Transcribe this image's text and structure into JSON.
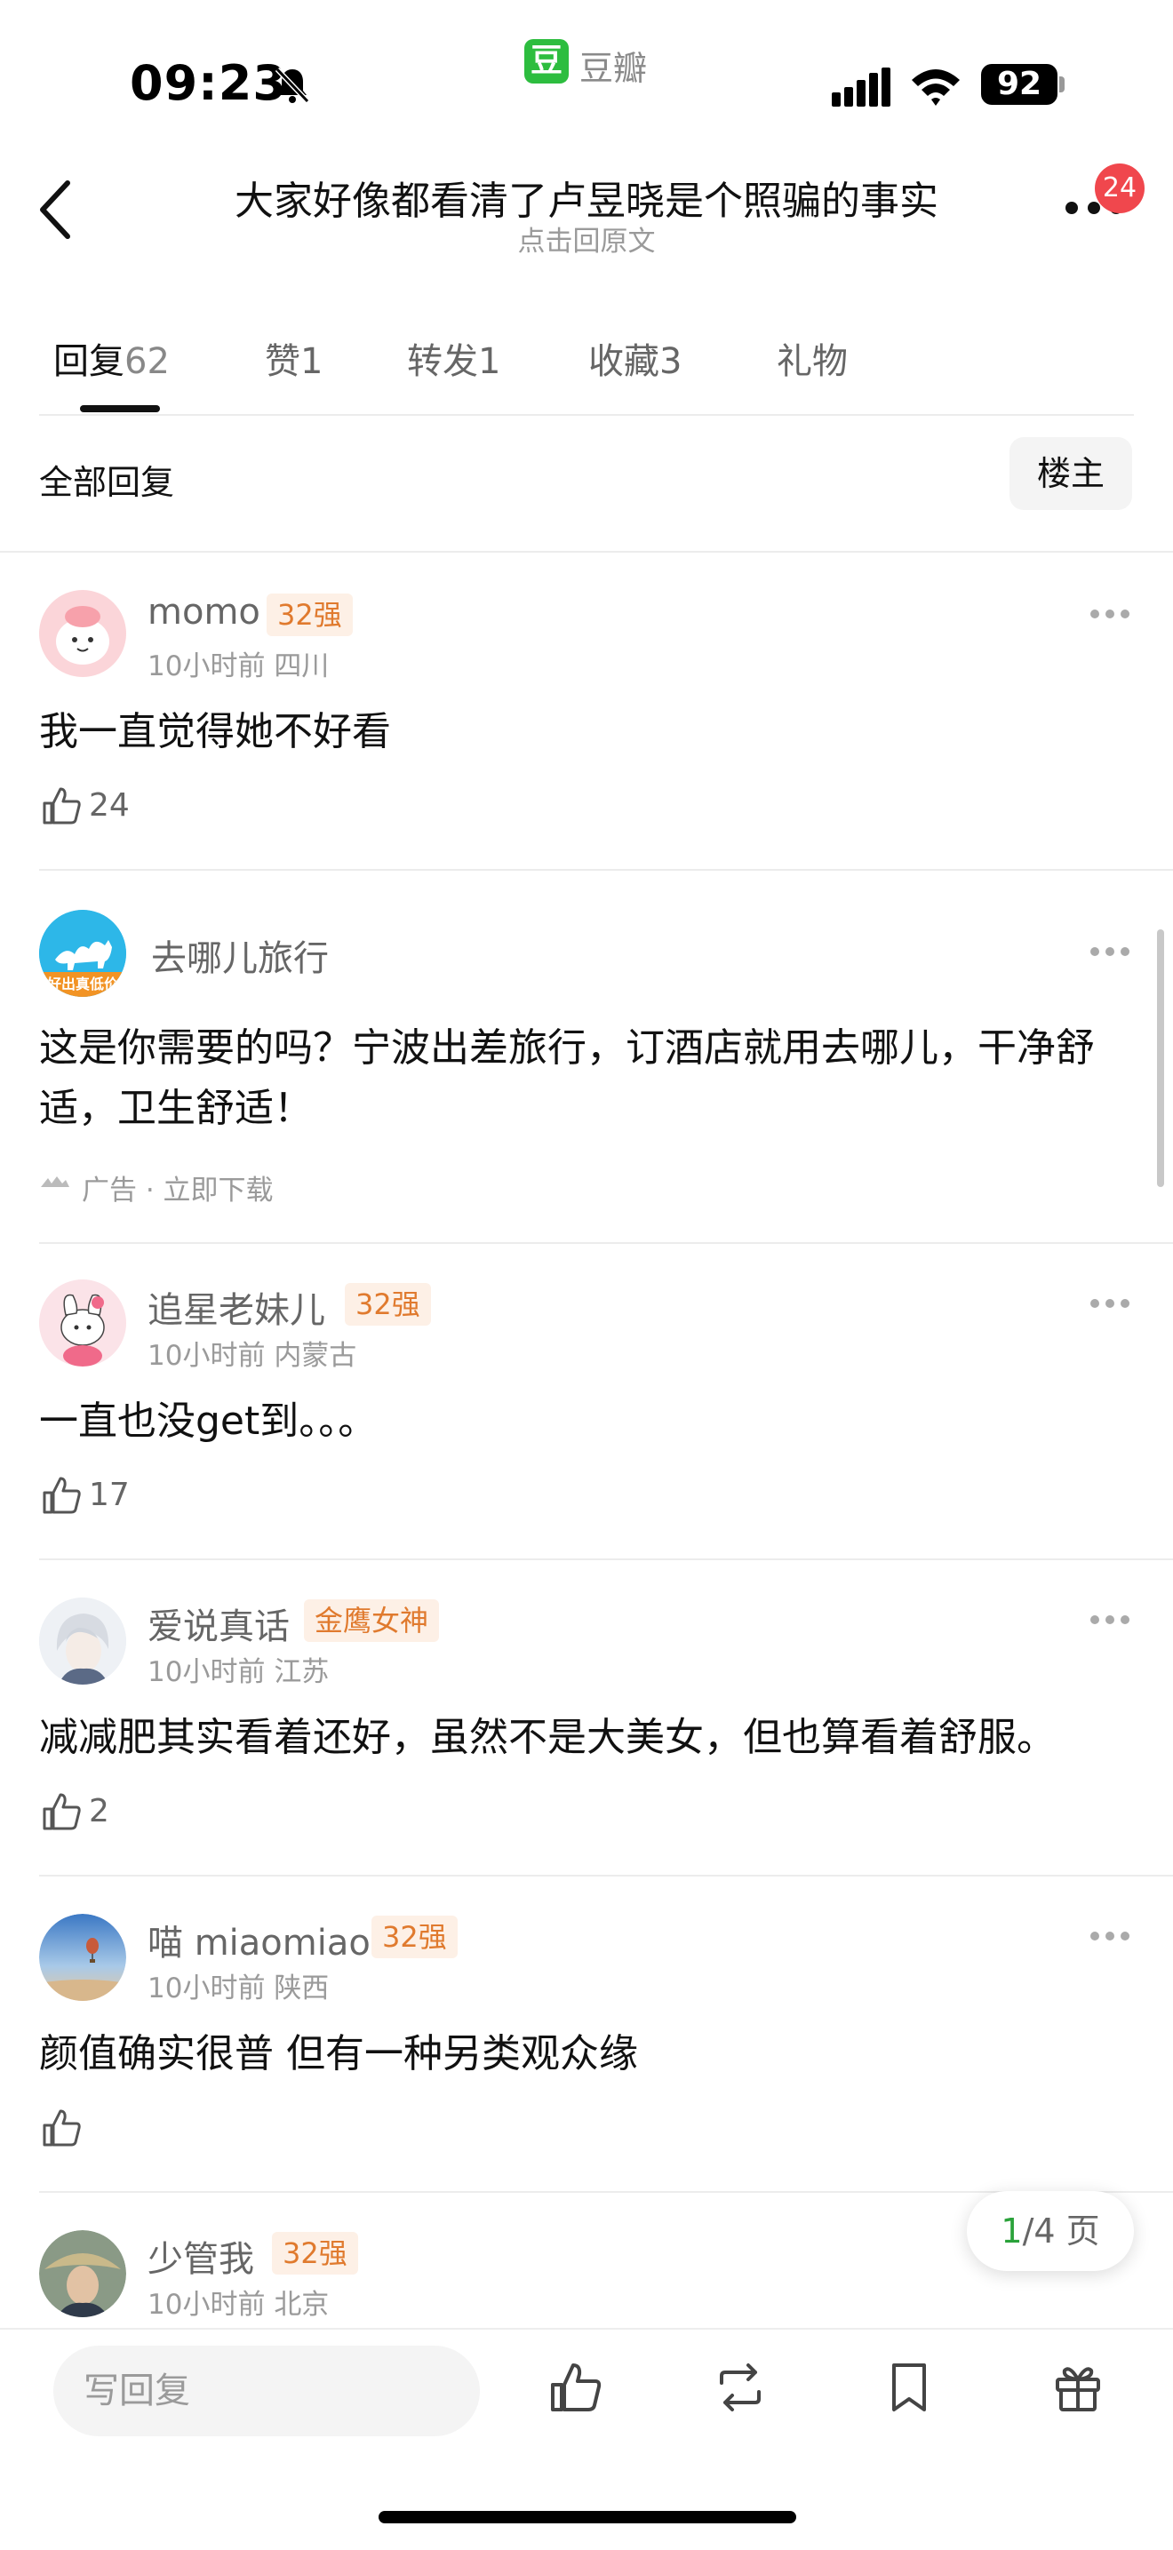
{
  "status_bar": {
    "time": "09:23",
    "app_logo": "豆",
    "app_name": "豆瓣",
    "battery": "92"
  },
  "nav": {
    "title": "大家好像都看清了卢昱晓是个照骗的事实",
    "subtitle": "点击回原文",
    "badge": "24"
  },
  "tabs": [
    {
      "label": "回复",
      "count": "62"
    },
    {
      "label": "赞",
      "count": "1"
    },
    {
      "label": "转发",
      "count": "1"
    },
    {
      "label": "收藏",
      "count": "3"
    },
    {
      "label": "礼物",
      "count": ""
    }
  ],
  "filter": {
    "all_replies": "全部回复",
    "op_only": "楼主"
  },
  "comments": [
    {
      "name": "momo",
      "tag": "32强",
      "time": "10小时前",
      "location": "四川",
      "text": "我一直觉得她不好看",
      "likes": "24"
    },
    {
      "name": "追星老妹儿",
      "tag": "32强",
      "time": "10小时前",
      "location": "内蒙古",
      "text": "一直也没get到。。。",
      "likes": "17"
    },
    {
      "name": "爱说真话",
      "tag": "金鹰女神",
      "time": "10小时前",
      "location": "江苏",
      "text": "减减肥其实看着还好，虽然不是大美女，但也算看着舒服。",
      "likes": "2"
    },
    {
      "name": "喵 miaomiao",
      "tag": "32强",
      "time": "10小时前",
      "location": "陕西",
      "text": "颜值确实很普 但有一种另类观众缘",
      "likes": ""
    },
    {
      "name": "少管我",
      "tag": "32强",
      "time": "10小时前",
      "location": "北京"
    }
  ],
  "ad": {
    "name": "去哪儿旅行",
    "text": "这是你需要的吗？宁波出差旅行，订酒店就用去哪儿，干净舒适，卫生舒适！",
    "footer": "广告 · 立即下载",
    "avatar_caption": "好出真低价"
  },
  "pager": {
    "current": "1",
    "total_text": "/4 页"
  },
  "bottom": {
    "reply_placeholder": "写回复"
  },
  "colors": {
    "brand_green": "#2dbd3f",
    "tag_orange": "#e07a2e",
    "badge_red": "#f0474d"
  }
}
